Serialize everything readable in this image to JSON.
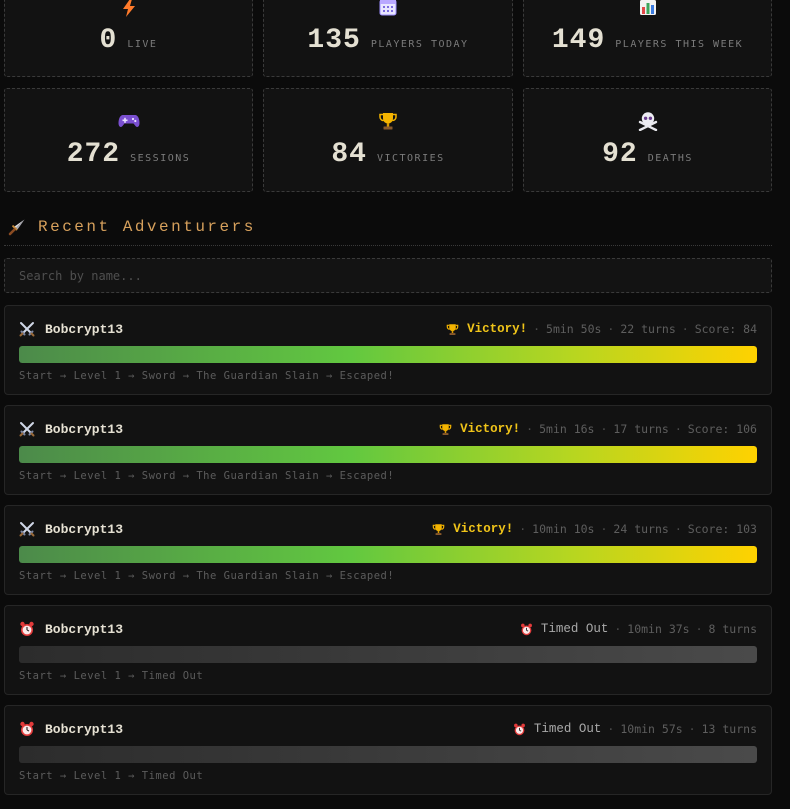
{
  "stats": [
    {
      "icon": "lightning-icon",
      "value": "0",
      "label": "LIVE"
    },
    {
      "icon": "calendar-icon",
      "value": "135",
      "label": "PLAYERS TODAY"
    },
    {
      "icon": "bar-chart-icon",
      "value": "149",
      "label": "PLAYERS THIS WEEK"
    },
    {
      "icon": "gamepad-icon",
      "value": "272",
      "label": "SESSIONS"
    },
    {
      "icon": "trophy-icon",
      "value": "84",
      "label": "VICTORIES"
    },
    {
      "icon": "skull-crossbones-icon",
      "value": "92",
      "label": "DEATHS"
    }
  ],
  "section": {
    "title": "Recent Adventurers",
    "icon": "dagger-icon",
    "title_color": "#d6a05c"
  },
  "search": {
    "placeholder": "Search by name...",
    "value": ""
  },
  "colors": {
    "victory": "#f0c419",
    "accent": "#d6a05c",
    "background": "#0b0b0b",
    "card": "#121212"
  },
  "runs": [
    {
      "player": "Bobcrypt13",
      "icon": "crossed-swords-icon",
      "outcome": "Victory!",
      "outcome_type": "victory",
      "duration": "5min 50s",
      "turns": "22 turns",
      "score": "Score: 84",
      "progress": 1.0,
      "path": "Start → Level 1 → Sword → The Guardian Slain → Escaped!"
    },
    {
      "player": "Bobcrypt13",
      "icon": "crossed-swords-icon",
      "outcome": "Victory!",
      "outcome_type": "victory",
      "duration": "5min 16s",
      "turns": "17 turns",
      "score": "Score: 106",
      "progress": 1.0,
      "path": "Start → Level 1 → Sword → The Guardian Slain → Escaped!"
    },
    {
      "player": "Bobcrypt13",
      "icon": "crossed-swords-icon",
      "outcome": "Victory!",
      "outcome_type": "victory",
      "duration": "10min 10s",
      "turns": "24 turns",
      "score": "Score: 103",
      "progress": 1.0,
      "path": "Start → Level 1 → Sword → The Guardian Slain → Escaped!"
    },
    {
      "player": "Bobcrypt13",
      "icon": "alarm-clock-icon",
      "outcome": "Timed Out",
      "outcome_type": "timeout",
      "duration": "10min 37s",
      "turns": "8 turns",
      "score": "",
      "progress": 1.0,
      "path": "Start → Level 1 → Timed Out"
    },
    {
      "player": "Bobcrypt13",
      "icon": "alarm-clock-icon",
      "outcome": "Timed Out",
      "outcome_type": "timeout",
      "duration": "10min 57s",
      "turns": "13 turns",
      "score": "",
      "progress": 1.0,
      "path": "Start → Level 1 → Timed Out"
    }
  ]
}
